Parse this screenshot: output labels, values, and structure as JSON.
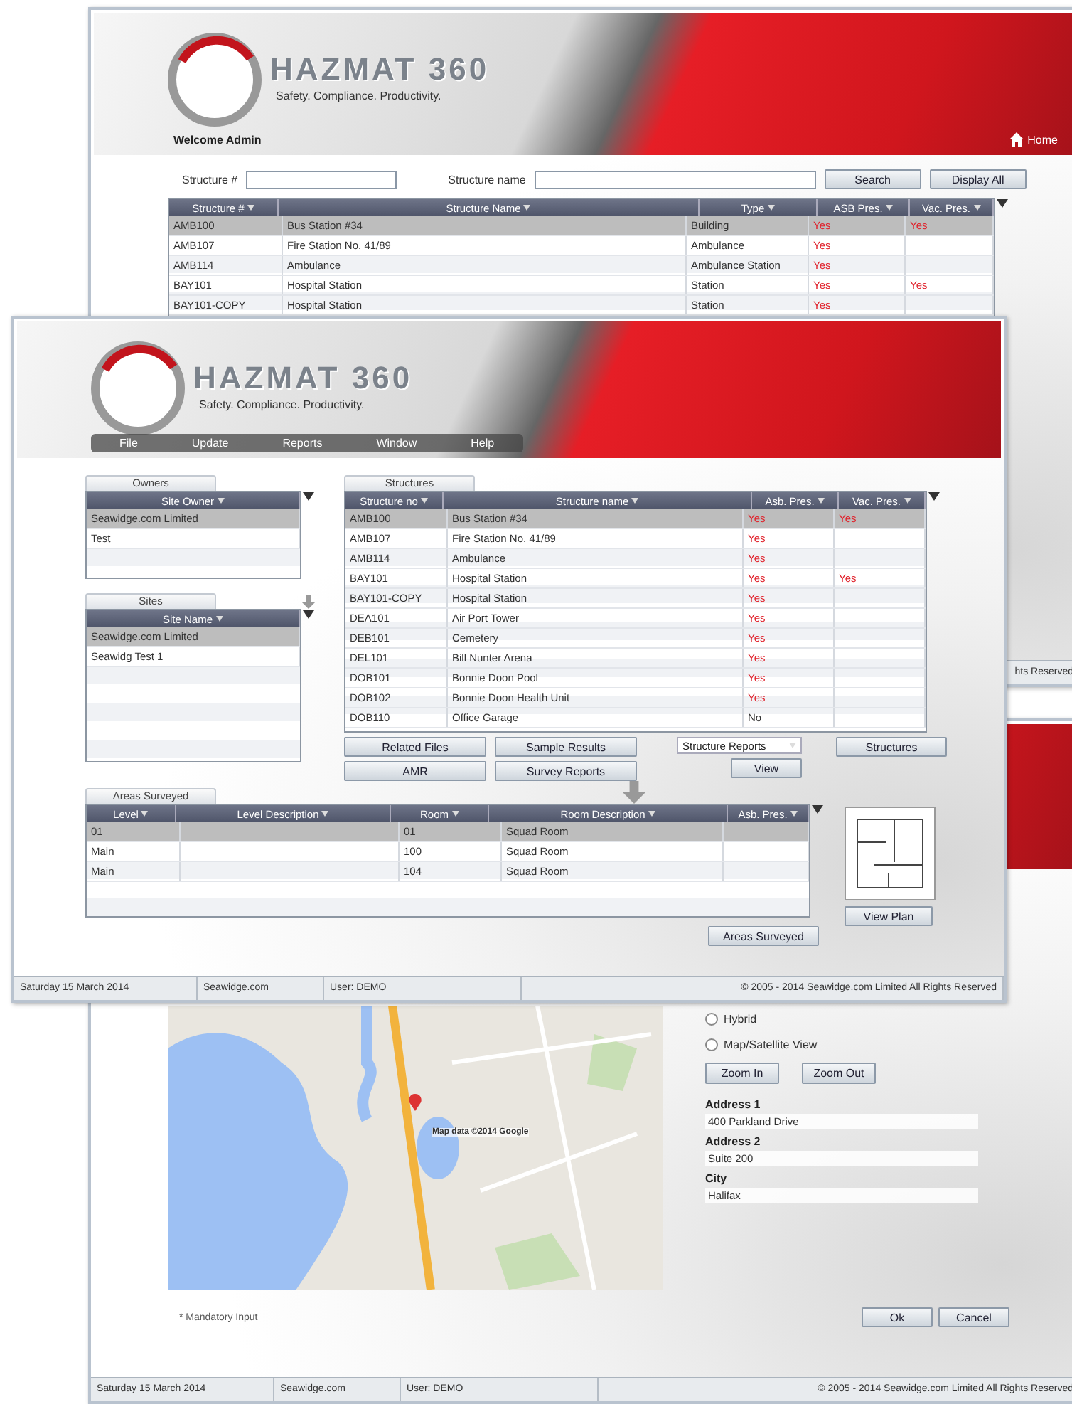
{
  "structure_search_window": {
    "logo": "HAZMAT 360",
    "tagline": "Safety. Compliance. Productivity.",
    "user_label": "Welcome Admin",
    "home_link": "Home",
    "search": {
      "number_label": "Structure #",
      "name_label": "Structure name",
      "buttons": [
        "Search",
        "Display All"
      ]
    },
    "table": {
      "columns": [
        {
          "label": "Structure #",
          "kind": "text"
        },
        {
          "label": "Structure Name",
          "kind": "text"
        },
        {
          "label": "Type",
          "kind": "text"
        },
        {
          "label": "ASB Pres.",
          "kind": "presence"
        },
        {
          "label": "Vac. Pres.",
          "kind": "presence"
        }
      ],
      "rows": [
        {
          "cells": [
            "AMB100",
            "Bus Station #34",
            "Building",
            "Yes",
            "Yes"
          ],
          "selected": true,
          "flagged": true
        },
        {
          "cells": [
            "AMB107",
            "Fire Station No. 41/89",
            "Ambulance",
            "Yes",
            null
          ],
          "selected": false,
          "flagged": true
        },
        {
          "cells": [
            "AMB114",
            "Ambulance",
            "Ambulance Station",
            "Yes",
            null
          ],
          "selected": false,
          "flagged": true
        },
        {
          "cells": [
            "BAY101",
            "Hospital Station",
            "Station",
            "Yes",
            "Yes"
          ],
          "selected": false,
          "flagged": true
        },
        {
          "cells": [
            "BAY101-COPY",
            "Hospital Station",
            "Station",
            "Yes",
            null
          ],
          "selected": false,
          "flagged": true
        }
      ]
    },
    "status_fragment": "hts Reserved"
  },
  "site_browser_window": {
    "logo": "HAZMAT 360",
    "tagline": "Safety. Compliance. Productivity.",
    "menu": [
      "File",
      "Update",
      "Reports",
      "Window",
      "Help"
    ],
    "owners": {
      "tab": "Owners",
      "columns": [
        {
          "label": "Site Owner"
        }
      ],
      "rows": [
        {
          "cells": [
            "Seawidge.com Limited"
          ],
          "selected": true
        },
        {
          "cells": [
            "Test"
          ],
          "selected": false
        }
      ]
    },
    "sites": {
      "tab": "Sites",
      "columns": [
        {
          "label": "Site Name"
        }
      ],
      "rows": [
        {
          "cells": [
            "Seawidge.com Limited"
          ],
          "selected": true
        },
        {
          "cells": [
            "Seawidg Test 1"
          ],
          "selected": false
        }
      ]
    },
    "structures": {
      "tab": "Structures",
      "columns": [
        {
          "label": "Structure no",
          "kind": "text"
        },
        {
          "label": "Structure name",
          "kind": "text"
        },
        {
          "label": "Asb. Pres.",
          "kind": "presence"
        },
        {
          "label": "Vac. Pres.",
          "kind": "presence"
        }
      ],
      "rows": [
        {
          "cells": [
            "AMB100",
            "Bus Station #34",
            "Yes",
            "Yes"
          ],
          "selected": true,
          "flagged": true
        },
        {
          "cells": [
            "AMB107",
            "Fire Station No. 41/89",
            "Yes",
            null
          ],
          "selected": false,
          "flagged": true
        },
        {
          "cells": [
            "AMB114",
            "Ambulance",
            "Yes",
            null
          ],
          "selected": false,
          "flagged": true
        },
        {
          "cells": [
            "BAY101",
            "Hospital Station",
            "Yes",
            "Yes"
          ],
          "selected": false,
          "flagged": true
        },
        {
          "cells": [
            "BAY101-COPY",
            "Hospital Station",
            "Yes",
            null
          ],
          "selected": false,
          "flagged": true
        },
        {
          "cells": [
            "DEA101",
            "Air Port Tower",
            "Yes",
            null
          ],
          "selected": false,
          "flagged": true
        },
        {
          "cells": [
            "DEB101",
            "Cemetery",
            "Yes",
            null
          ],
          "selected": false,
          "flagged": true
        },
        {
          "cells": [
            "DEL101",
            "Bill Nunter Arena",
            "Yes",
            null
          ],
          "selected": false,
          "flagged": true
        },
        {
          "cells": [
            "DOB101",
            "Bonnie Doon Pool",
            "Yes",
            null
          ],
          "selected": false,
          "flagged": true
        },
        {
          "cells": [
            "DOB102",
            "Bonnie Doon Health Unit",
            "Yes",
            null
          ],
          "selected": false,
          "flagged": true
        },
        {
          "cells": [
            "DOB110",
            "Office Garage",
            "No",
            null
          ],
          "selected": false,
          "flagged": false
        }
      ]
    },
    "actions": [
      "Related Files",
      "Sample Results",
      "AMR",
      "Survey Reports"
    ],
    "report_select": "Structure Reports",
    "view_button": "View",
    "structures_button": "Structures",
    "areas": {
      "tab": "Areas Surveyed",
      "columns": [
        {
          "label": "Level"
        },
        {
          "label": "Level Description"
        },
        {
          "label": "Room"
        },
        {
          "label": "Room Description"
        },
        {
          "label": "Asb. Pres."
        }
      ],
      "rows": [
        {
          "cells": [
            "01",
            null,
            "01",
            "Squad Room",
            null
          ],
          "selected": true
        },
        {
          "cells": [
            "Main",
            null,
            "100",
            "Squad Room",
            null
          ],
          "selected": false
        },
        {
          "cells": [
            "Main",
            null,
            "104",
            "Squad Room",
            null
          ],
          "selected": false
        }
      ]
    },
    "view_plan": "View Plan",
    "areas_button": "Areas Surveyed",
    "status_bar": [
      "Saturday 15 March 2014",
      "Seawidge.com",
      "User: DEMO",
      "© 2005 - 2014 Seawidge.com Limited All Rights Reserved"
    ]
  },
  "address_window": {
    "map_attribution": "Map data ©2014 Google",
    "view_options": [
      {
        "label": "Hybrid",
        "selected": false
      },
      {
        "label": "Map/Satellite View",
        "selected": false
      }
    ],
    "zoom_buttons": [
      "Zoom In",
      "Zoom Out"
    ],
    "fields": [
      {
        "label": "Address 1",
        "value": "400 Parkland Drive"
      },
      {
        "label": "Address 2",
        "value": "Suite 200"
      },
      {
        "label": "City",
        "value": "Halifax"
      }
    ],
    "mandatory_note": "* Mandatory Input",
    "buttons": [
      "Ok",
      "Cancel"
    ],
    "status_bar": [
      "Saturday 15 March 2014",
      "Seawidge.com",
      "User: DEMO",
      "© 2005 - 2014 Seawidge.com Limited All Rights Reserved"
    ]
  }
}
